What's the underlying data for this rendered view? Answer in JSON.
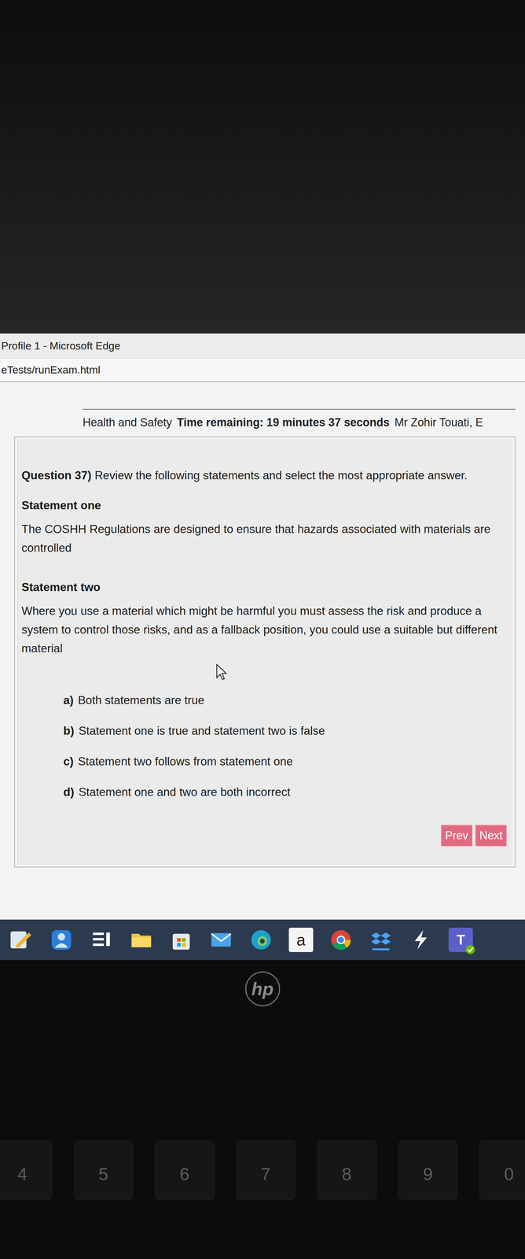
{
  "browser": {
    "title": "Profile 1 - Microsoft Edge",
    "address": "eTests/runExam.html"
  },
  "exam": {
    "subject": "Health and Safety",
    "timer": "Time remaining: 19 minutes 37 seconds",
    "candidate": "Mr Zohir Touati, E"
  },
  "question": {
    "number": "Question 37)",
    "prompt": "Review the following statements and select the most appropriate answer.",
    "statements": [
      {
        "title": "Statement one",
        "text": "The COSHH Regulations are designed to ensure that hazards associated with materials are controlled"
      },
      {
        "title": "Statement two",
        "text": "Where you use a material which might be harmful you must assess the risk and produce a system to control those risks, and as a fallback position, you could use a suitable but different material"
      }
    ],
    "options": [
      {
        "letter": "a)",
        "text": "Both statements are true"
      },
      {
        "letter": "b)",
        "text": "Statement one is true and statement two is false"
      },
      {
        "letter": "c)",
        "text": "Statement two follows from statement one"
      },
      {
        "letter": "d)",
        "text": "Statement one and two are both incorrect"
      }
    ]
  },
  "nav_buttons": [
    "Prev",
    "Next"
  ],
  "taskbar": {
    "amazon_label": "a",
    "teams_label": "T"
  },
  "laptop": {
    "logo": "hp",
    "keys": [
      "4",
      "5",
      "6",
      "7",
      "8",
      "9",
      "0"
    ]
  }
}
